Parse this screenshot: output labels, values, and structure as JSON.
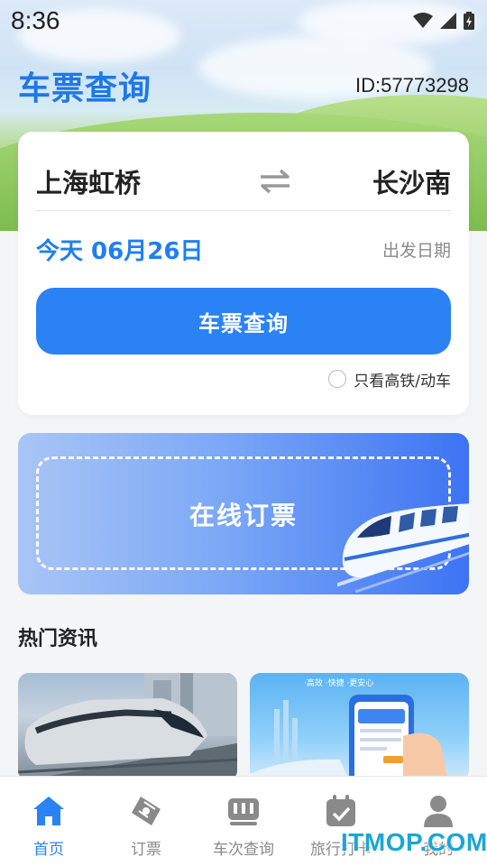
{
  "status_bar": {
    "time": "8:36"
  },
  "header": {
    "title": "车票查询",
    "user_id": "ID:57773298"
  },
  "query": {
    "from_station": "上海虹桥",
    "to_station": "长沙南",
    "date": "今天 06月26日",
    "date_label": "出发日期",
    "search_label": "车票查询",
    "high_speed_only_label": "只看高铁/动车",
    "high_speed_only_checked": false
  },
  "banner": {
    "label": "在线订票"
  },
  "news": {
    "heading": "热门资讯",
    "card_2_caption": "·高效 ·快捷 ·更安心"
  },
  "nav": {
    "items": [
      {
        "label": "首页",
        "icon": "home-icon",
        "active": true
      },
      {
        "label": "订票",
        "icon": "ticket-icon",
        "active": false
      },
      {
        "label": "车次查询",
        "icon": "train-schedule-icon",
        "active": false
      },
      {
        "label": "旅行打卡",
        "icon": "calendar-check-icon",
        "active": false
      },
      {
        "label": "我的",
        "icon": "user-icon",
        "active": false
      }
    ]
  },
  "watermark": "ITMOP.COM",
  "colors": {
    "accent": "#2a82f5",
    "title_blue": "#1f78e6",
    "inactive": "#8a8a8a"
  }
}
